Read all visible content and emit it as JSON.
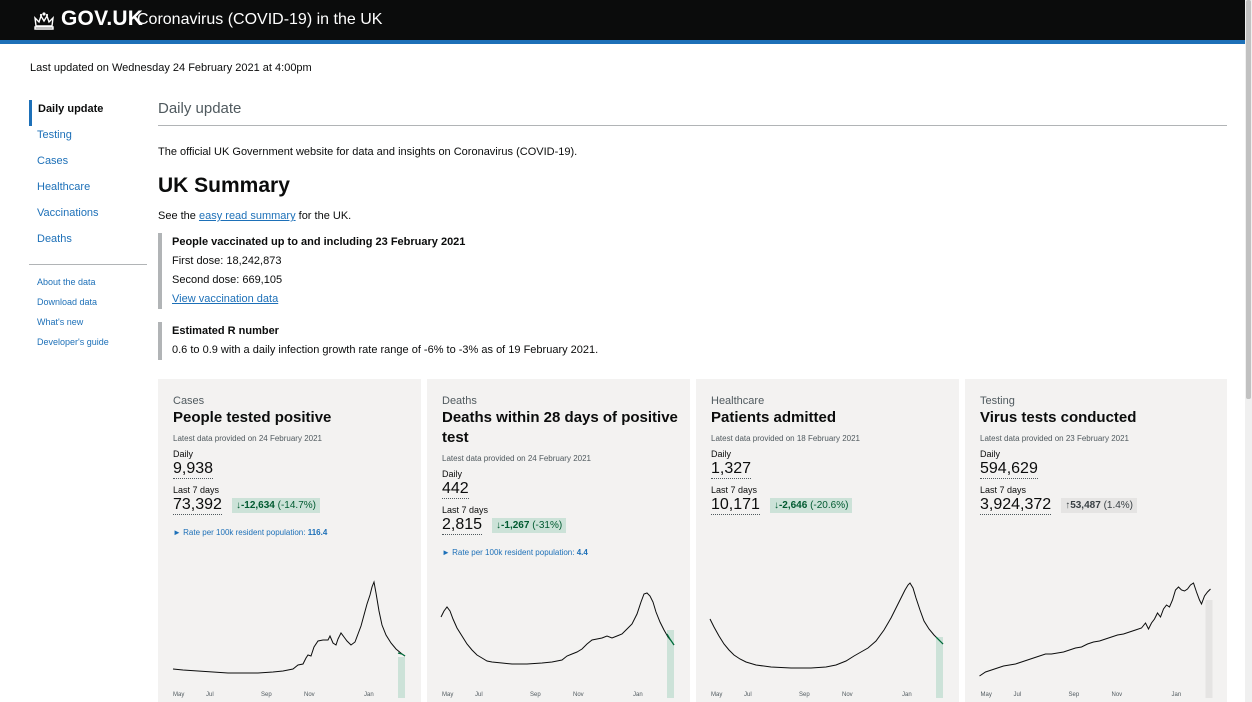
{
  "header": {
    "logo_text": "GOV.UK",
    "service_name": "Coronavirus (COVID-19) in the UK",
    "colors": {
      "bar": "#0b0c0c",
      "accent": "#1d70b8"
    }
  },
  "last_updated": "Last updated on Wednesday 24 February 2021 at 4:00pm",
  "nav": {
    "main": [
      {
        "label": "Daily update",
        "active": true
      },
      {
        "label": "Testing"
      },
      {
        "label": "Cases"
      },
      {
        "label": "Healthcare"
      },
      {
        "label": "Vaccinations"
      },
      {
        "label": "Deaths"
      }
    ],
    "secondary": [
      {
        "label": "About the data"
      },
      {
        "label": "Download data"
      },
      {
        "label": "What's new"
      },
      {
        "label": "Developer's guide"
      }
    ]
  },
  "main": {
    "heading": "Daily update",
    "intro": "The official UK Government website for data and insights on Coronavirus (COVID-19).",
    "summary_title": "UK Summary",
    "easy_read": {
      "before": "See the ",
      "link": "easy read summary",
      "after": " for the UK."
    },
    "vaccinations": {
      "title": "People vaccinated up to and including 23 February 2021",
      "first": "First dose: 18,242,873",
      "second": "Second dose: 669,105",
      "link": "View vaccination data"
    },
    "r_number": {
      "title": "Estimated R number",
      "text": "0.6 to 0.9 with a daily infection growth rate range of -6% to -3% as of 19 February 2021."
    }
  },
  "cards": [
    {
      "category": "Cases",
      "headline": "People tested positive",
      "latest": "Latest data provided on 24 February 2021",
      "daily_label": "Daily",
      "daily_value": "9,938",
      "week_label": "Last 7 days",
      "week_value": "73,392",
      "change_arrow": "↓",
      "change_value": "-12,634",
      "change_pct": "(-14.7%)",
      "change_color": "green",
      "rate_label": "Rate per 100k resident population:",
      "rate_value": "116.4",
      "months": [
        "May",
        "Jul",
        "Sep",
        "Nov",
        "Jan"
      ]
    },
    {
      "category": "Deaths",
      "headline": "Deaths within 28 days of positive test",
      "latest": "Latest data provided on 24 February 2021",
      "daily_label": "Daily",
      "daily_value": "442",
      "week_label": "Last 7 days",
      "week_value": "2,815",
      "change_arrow": "↓",
      "change_value": "-1,267",
      "change_pct": "(-31%)",
      "change_color": "green",
      "rate_label": "Rate per 100k resident population:",
      "rate_value": "4.4",
      "months": [
        "May",
        "Jul",
        "Sep",
        "Nov",
        "Jan"
      ]
    },
    {
      "category": "Healthcare",
      "headline": "Patients admitted",
      "latest": "Latest data provided on 18 February 2021",
      "daily_label": "Daily",
      "daily_value": "1,327",
      "week_label": "Last 7 days",
      "week_value": "10,171",
      "change_arrow": "↓",
      "change_value": "-2,646",
      "change_pct": "(-20.6%)",
      "change_color": "green",
      "months": [
        "May",
        "Jul",
        "Sep",
        "Nov",
        "Jan"
      ]
    },
    {
      "category": "Testing",
      "headline": "Virus tests conducted",
      "latest": "Latest data provided on 23 February 2021",
      "daily_label": "Daily",
      "daily_value": "594,629",
      "week_label": "Last 7 days",
      "week_value": "3,924,372",
      "change_arrow": "↑",
      "change_value": "53,487",
      "change_pct": "(1.4%)",
      "change_color": "grey",
      "months": [
        "May",
        "Jul",
        "Sep",
        "Nov",
        "Jan"
      ]
    }
  ]
}
